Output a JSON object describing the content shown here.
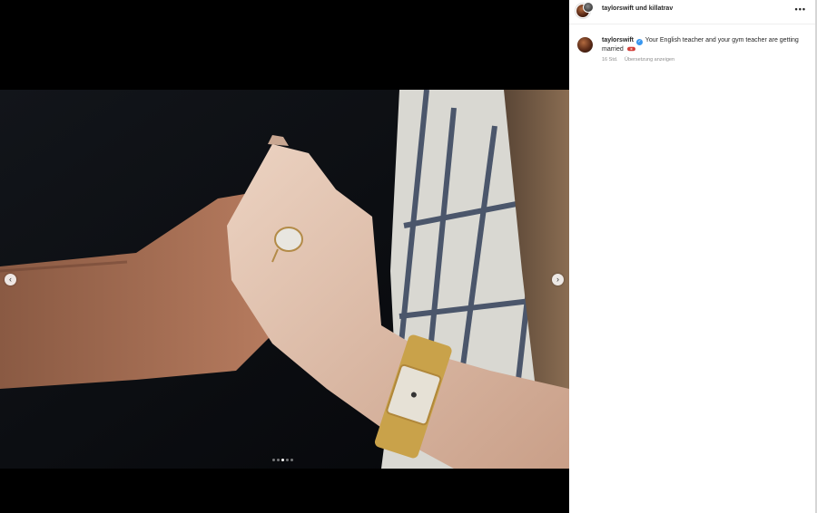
{
  "post_header": {
    "author": "taylorswift",
    "conjunction": "und",
    "coauthor": "killatrav",
    "more_icon": "more-horizontal-icon"
  },
  "caption": {
    "username": "taylorswift",
    "verified_icon": "verified-badge-icon",
    "text": "Your English teacher and your gym teacher are getting married",
    "emoji": "ring-emoji"
  },
  "meta": {
    "time": "16 Std.",
    "translate_label": "Übersetzung anzeigen"
  },
  "carousel": {
    "prev_label": "‹",
    "next_label": "›",
    "total_slides": 5,
    "active_slide": 3
  },
  "colors": {
    "verified": "#3897f0",
    "panel_bg": "#ffffff",
    "text": "#262626",
    "muted": "#8e8e8e"
  }
}
